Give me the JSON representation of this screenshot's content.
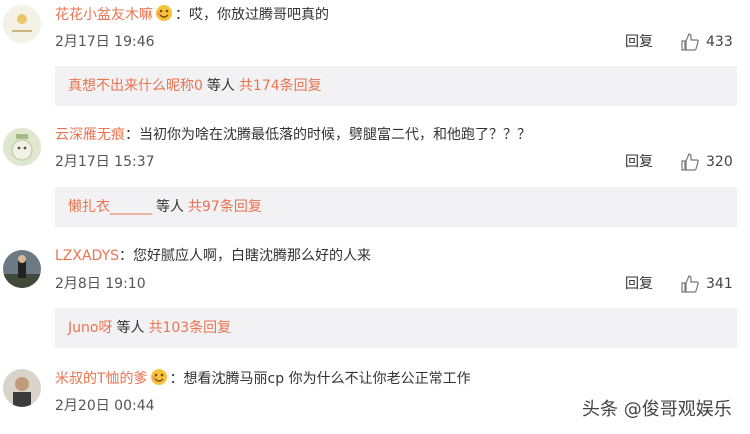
{
  "comments": [
    {
      "user": "花花小盆友木嘛",
      "text": "：哎，你放过腾哥吧真的",
      "time": "2月17日 19:46",
      "reply": "回复",
      "likes": "433",
      "sub_user": "真想不出来什么昵称0",
      "sub_mid": "等人",
      "sub_count": "共174条回复",
      "has_emoji": true
    },
    {
      "user": "云深雁无痕",
      "text": "：当初你为啥在沈腾最低落的时候，劈腿富二代，和他跑了？？？",
      "time": "2月17日 15:37",
      "reply": "回复",
      "likes": "320",
      "sub_user": "懒扎衣______",
      "sub_mid": "等人",
      "sub_count": "共97条回复",
      "has_emoji": false
    },
    {
      "user": "LZXADYS",
      "text": "：您好腻应人啊，白瞎沈腾那么好的人来",
      "time": "2月8日 19:10",
      "reply": "回复",
      "likes": "341",
      "sub_user": "Juno呀",
      "sub_mid": "等人",
      "sub_count": "共103条回复",
      "has_emoji": false
    },
    {
      "user": "米叔的T恤的爹",
      "text": "：想看沈腾马丽cp 你为什么不让你老公正常工作",
      "time": "2月20日 00:44",
      "reply": "",
      "likes": "",
      "has_emoji": true
    }
  ],
  "watermark": "头条 @俊哥观娱乐",
  "icons": {
    "like": "thumbs-up-icon",
    "emoji": "emoji-face-icon"
  },
  "colors": {
    "username": "#eb7350",
    "subbox_bg": "#f2f2f5"
  }
}
